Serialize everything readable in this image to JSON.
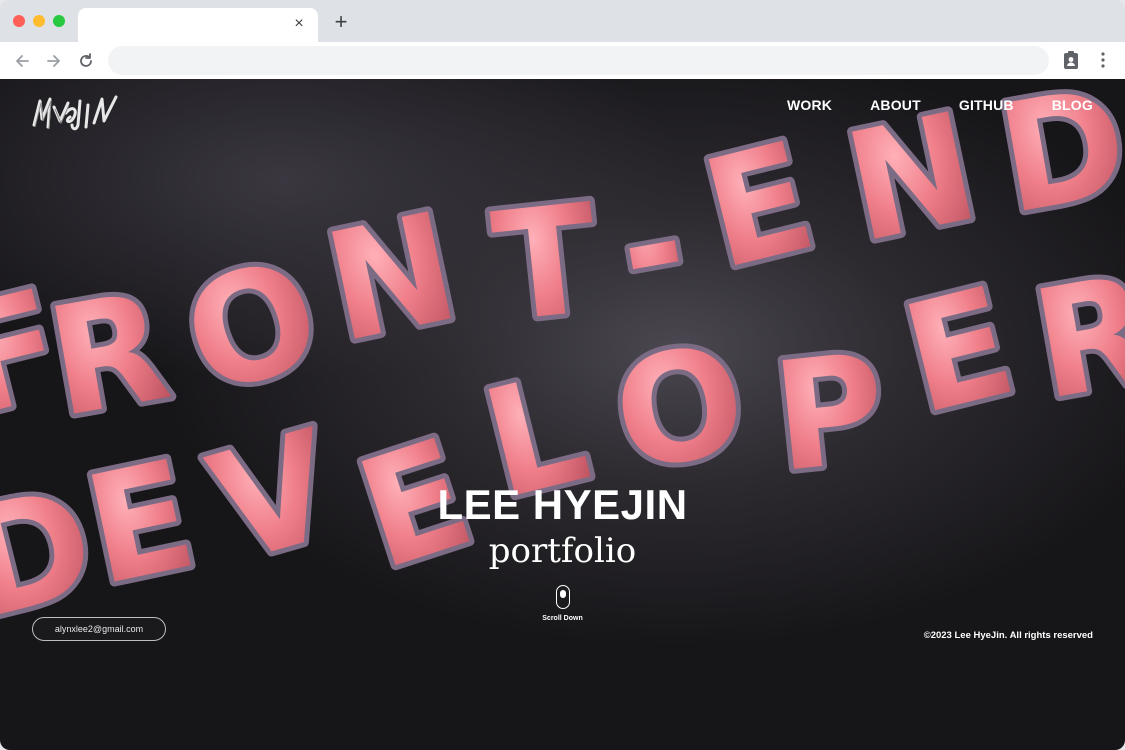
{
  "browser": {
    "tab_close": "×",
    "new_tab": "+",
    "url": ""
  },
  "site": {
    "logo_text": "HYEJIN",
    "nav": [
      "WORK",
      "ABOUT",
      "GITHUB",
      "BLOG"
    ],
    "hero_title": "LEE HYEJIN",
    "hero_subtitle": "portfolio",
    "scroll_label": "Scroll Down",
    "email": "alynxlee2@gmail.com",
    "copyright": "©2023 Lee HyeJin. All rights reserved",
    "background_letters": "FRONT-END DEVELOPER"
  },
  "colors": {
    "letter_pink": "#ee7d88",
    "background": "#161518"
  }
}
